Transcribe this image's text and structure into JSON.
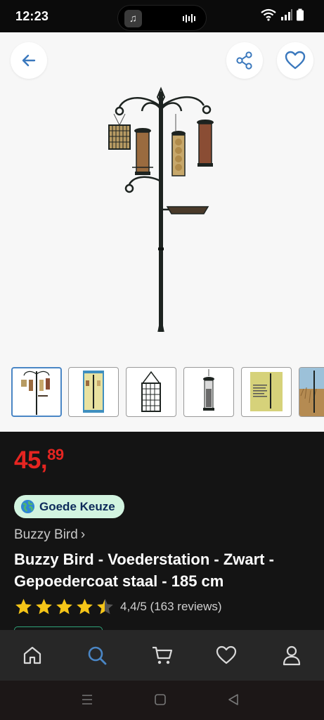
{
  "status_bar": {
    "time": "12:23",
    "music_icon": "music-note-icon"
  },
  "gallery": {
    "back_icon": "arrow-left-icon",
    "share_icon": "share-icon",
    "favorite_icon": "heart-outline-icon",
    "main_image": "bird-feeding-station-photo",
    "thumbnails": [
      {
        "name": "thumb-feeding-station",
        "selected": true
      },
      {
        "name": "thumb-package-front",
        "selected": false
      },
      {
        "name": "thumb-suet-cage",
        "selected": false
      },
      {
        "name": "thumb-seed-feeder",
        "selected": false
      },
      {
        "name": "thumb-package-label",
        "selected": false
      },
      {
        "name": "thumb-outdoor-photo",
        "selected": false
      }
    ]
  },
  "product": {
    "price_integer": "45,",
    "price_decimal": "89",
    "badge_label": "Goede Keuze",
    "brand": "Buzzy Bird",
    "brand_chevron": "›",
    "title": "Buzzy Bird - Voederstation - Zwart - Gepoedercoat staal - 185 cm",
    "rating_value": 4.4,
    "rating_text": "4,4/5 (163 reviews)"
  },
  "colors": {
    "price": "#e52521",
    "badge_bg": "#d2f4e0",
    "badge_text": "#0d2a5a",
    "active_nav": "#4a86c5",
    "star": "#f5c518"
  },
  "bottom_nav": [
    {
      "name": "nav-home",
      "icon": "home-icon",
      "active": false
    },
    {
      "name": "nav-search",
      "icon": "search-icon",
      "active": true
    },
    {
      "name": "nav-cart",
      "icon": "cart-icon",
      "active": false
    },
    {
      "name": "nav-wishlist",
      "icon": "heart-icon",
      "active": false
    },
    {
      "name": "nav-account",
      "icon": "user-icon",
      "active": false
    }
  ],
  "system_nav": [
    "menu-icon",
    "home-square-icon",
    "back-triangle-icon"
  ]
}
